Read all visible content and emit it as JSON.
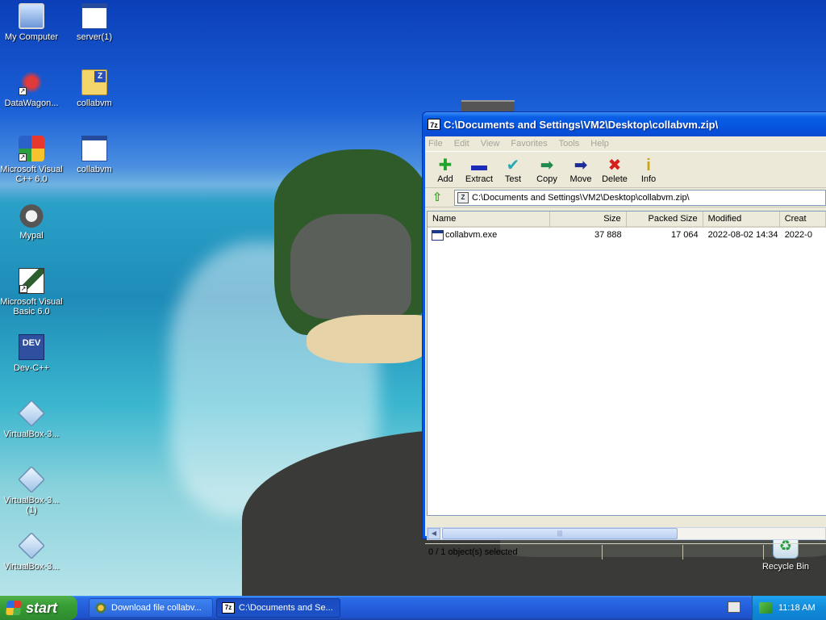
{
  "desktop": {
    "icons": [
      {
        "label": "My Computer",
        "icon": "my-computer-icon"
      },
      {
        "label": "server(1)",
        "icon": "window-icon"
      },
      {
        "label": "DataWagon...",
        "icon": "datawagon-icon"
      },
      {
        "label": "collabvm",
        "icon": "zip-folder-icon"
      },
      {
        "label": "Microsoft Visual C++ 6.0",
        "icon": "visual-cpp-icon"
      },
      {
        "label": "collabvm",
        "icon": "window-icon"
      },
      {
        "label": "Mypal",
        "icon": "mypal-icon"
      },
      {
        "label": "Microsoft Visual Basic 6.0",
        "icon": "visual-basic-icon"
      },
      {
        "label": "Dev-C++",
        "icon": "dev-cpp-icon"
      },
      {
        "label": "VirtualBox-3...",
        "icon": "virtualbox-icon"
      },
      {
        "label": "VirtualBox-3... (1)",
        "icon": "virtualbox-icon"
      },
      {
        "label": "VirtualBox-3...",
        "icon": "virtualbox-icon"
      },
      {
        "label": "Recycle Bin",
        "icon": "recycle-bin-icon"
      }
    ],
    "dev_icon_text": "DEV"
  },
  "window": {
    "title": "C:\\Documents and Settings\\VM2\\Desktop\\collabvm.zip\\",
    "app_icon_text": "7z",
    "menu": [
      "File",
      "Edit",
      "View",
      "Favorites",
      "Tools",
      "Help"
    ],
    "toolbar": [
      {
        "label": "Add",
        "icon": "add-icon",
        "glyph": "✚"
      },
      {
        "label": "Extract",
        "icon": "extract-icon",
        "glyph": "▬"
      },
      {
        "label": "Test",
        "icon": "test-icon",
        "glyph": "✔"
      },
      {
        "label": "Copy",
        "icon": "copy-icon",
        "glyph": "➡"
      },
      {
        "label": "Move",
        "icon": "move-icon",
        "glyph": "➡"
      },
      {
        "label": "Delete",
        "icon": "delete-icon",
        "glyph": "✖"
      },
      {
        "label": "Info",
        "icon": "info-icon",
        "glyph": "i"
      }
    ],
    "address": "C:\\Documents and Settings\\VM2\\Desktop\\collabvm.zip\\",
    "columns": [
      "Name",
      "Size",
      "Packed Size",
      "Modified",
      "Creat"
    ],
    "rows": [
      {
        "name": "collabvm.exe",
        "size": "37 888",
        "packed": "17 064",
        "modified": "2022-08-02 14:34",
        "created": "2022-0"
      }
    ],
    "status": "0 / 1 object(s) selected"
  },
  "taskbar": {
    "start_label": "start",
    "tasks": [
      {
        "label": "Download file collabv...",
        "icon": "internet-explorer-icon"
      },
      {
        "label": "C:\\Documents and Se...",
        "icon": "seven-zip-icon"
      }
    ],
    "clock": "11:18 AM"
  }
}
